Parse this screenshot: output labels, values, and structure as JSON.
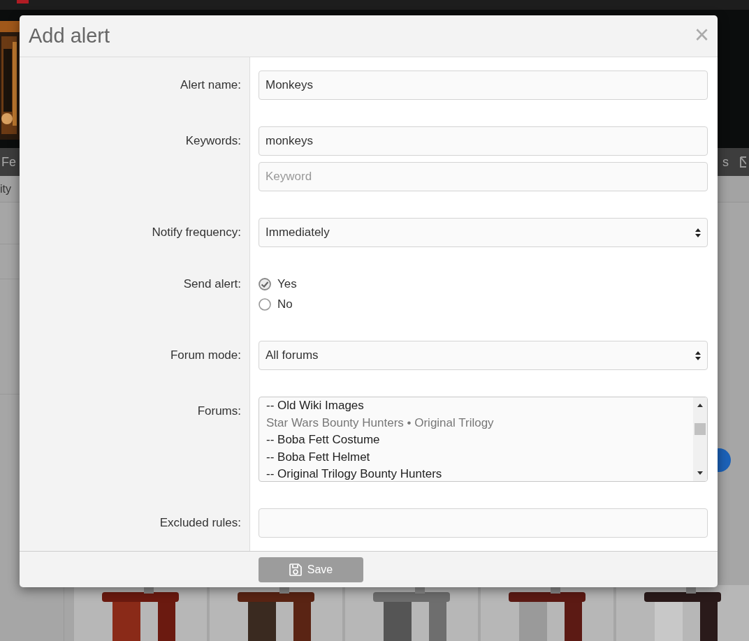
{
  "background": {
    "nav_left": "Fe",
    "nav_right": "s",
    "subnav": "ity"
  },
  "dialog": {
    "title": "Add alert",
    "close": "×",
    "fields": [
      {
        "kind": "text",
        "label": "Alert name:",
        "inputs": [
          {
            "value": "Monkeys"
          }
        ]
      },
      {
        "kind": "text",
        "label": "Keywords:",
        "inputs": [
          {
            "value": "monkeys"
          },
          {
            "placeholder": "Keyword"
          }
        ]
      },
      {
        "kind": "select",
        "label": "Notify frequency:",
        "value": "Immediately"
      },
      {
        "kind": "radio",
        "label": "Send alert:",
        "options": [
          {
            "label": "Yes",
            "selected": true
          },
          {
            "label": "No",
            "selected": false
          }
        ]
      },
      {
        "kind": "select",
        "label": "Forum mode:",
        "value": "All forums"
      },
      {
        "kind": "listbox",
        "label": "Forums:",
        "items": [
          {
            "kind": "option",
            "label": "-- Old Wiki Images"
          },
          {
            "kind": "group",
            "label": "Star Wars Bounty Hunters • Original Trilogy"
          },
          {
            "kind": "option",
            "label": "-- Boba Fett Costume"
          },
          {
            "kind": "option",
            "label": "-- Boba Fett Helmet"
          },
          {
            "kind": "option",
            "label": "-- Original Trilogy Bounty Hunters"
          }
        ]
      },
      {
        "kind": "text",
        "label": "Excluded rules:"
      }
    ],
    "save": "Save"
  }
}
